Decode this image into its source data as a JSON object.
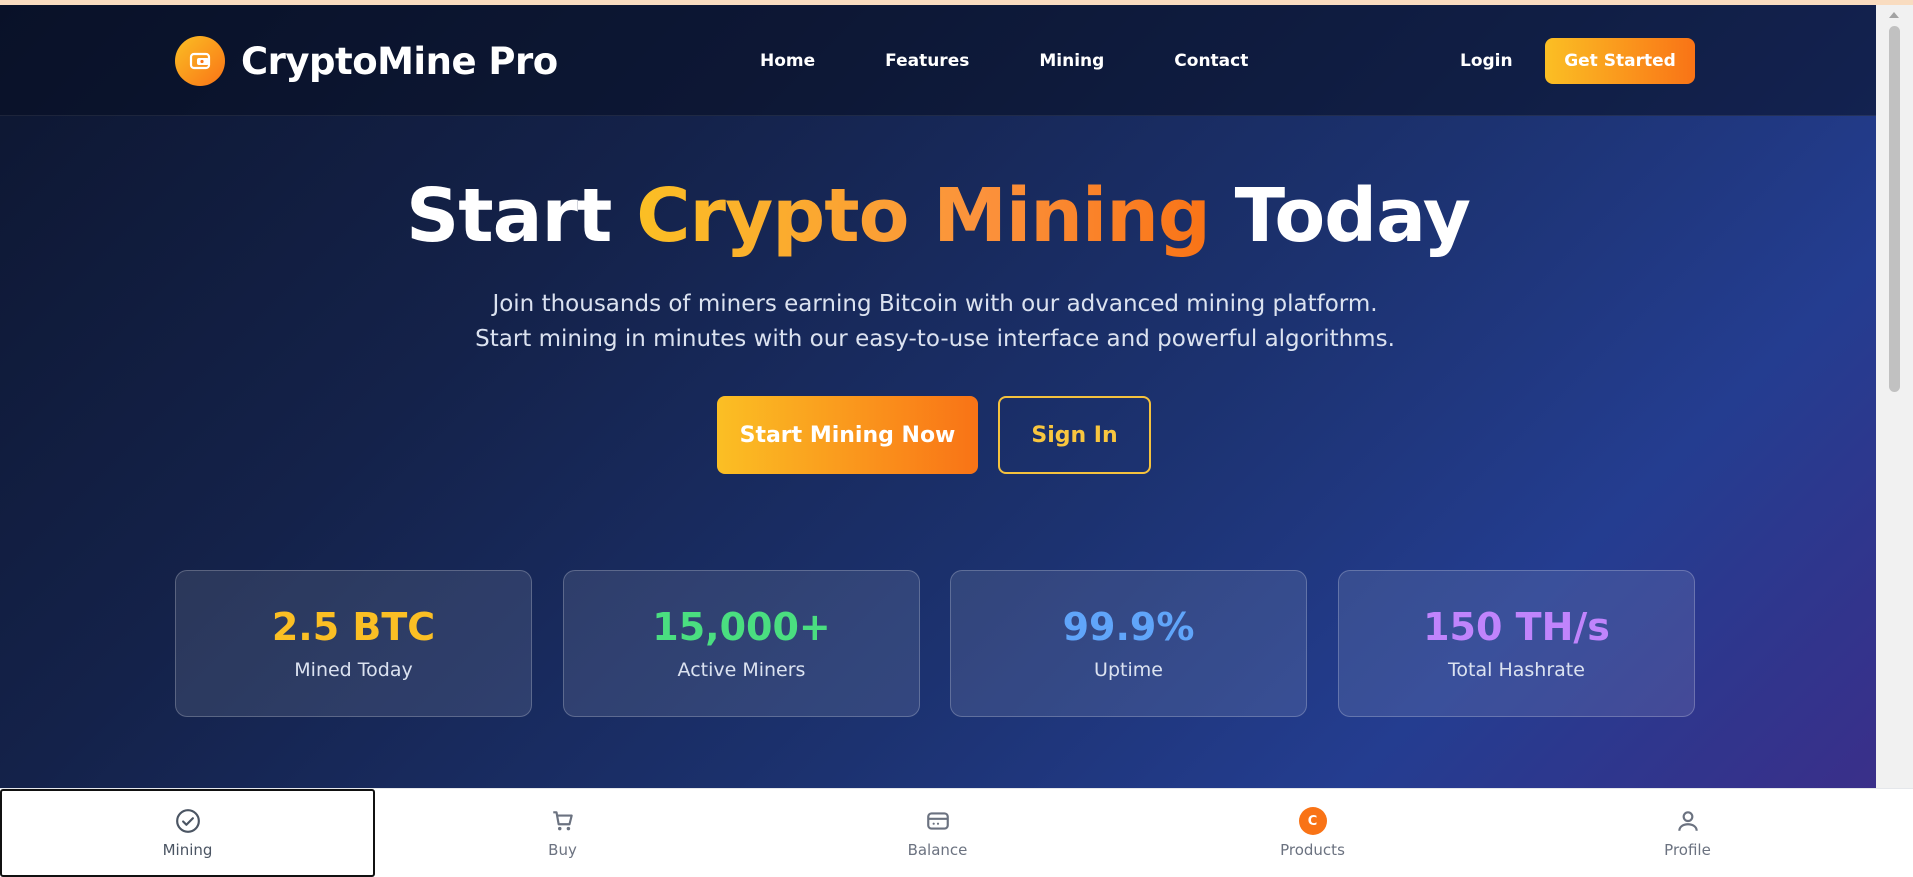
{
  "header": {
    "brand": "CryptoMine Pro",
    "nav": [
      "Home",
      "Features",
      "Mining",
      "Contact"
    ],
    "login": "Login",
    "cta": "Get Started"
  },
  "hero": {
    "title_start": "Start",
    "title_highlight": "Crypto Mining",
    "title_end": "Today",
    "subtitle": "Join thousands of miners earning Bitcoin with our advanced mining platform. Start mining in minutes with our easy-to-use interface and powerful algorithms.",
    "primary_button": "Start Mining Now",
    "secondary_button": "Sign In"
  },
  "stats": [
    {
      "value": "2.5 BTC",
      "label": "Mined Today",
      "color": "#fbbf24"
    },
    {
      "value": "15,000+",
      "label": "Active Miners",
      "color": "#4ade80"
    },
    {
      "value": "99.9%",
      "label": "Uptime",
      "color": "#60a5fa"
    },
    {
      "value": "150 TH/s",
      "label": "Total Hashrate",
      "color": "#c084fc"
    }
  ],
  "bottom_nav": [
    {
      "label": "Mining",
      "icon": "check-circle-icon",
      "active": true
    },
    {
      "label": "Buy",
      "icon": "cart-icon"
    },
    {
      "label": "Balance",
      "icon": "wallet-icon"
    },
    {
      "label": "Products",
      "icon": "coin-badge-icon",
      "badge": "C"
    },
    {
      "label": "Profile",
      "icon": "user-icon"
    }
  ],
  "colors": {
    "accent_start": "#fbbf24",
    "accent_end": "#f97316"
  }
}
